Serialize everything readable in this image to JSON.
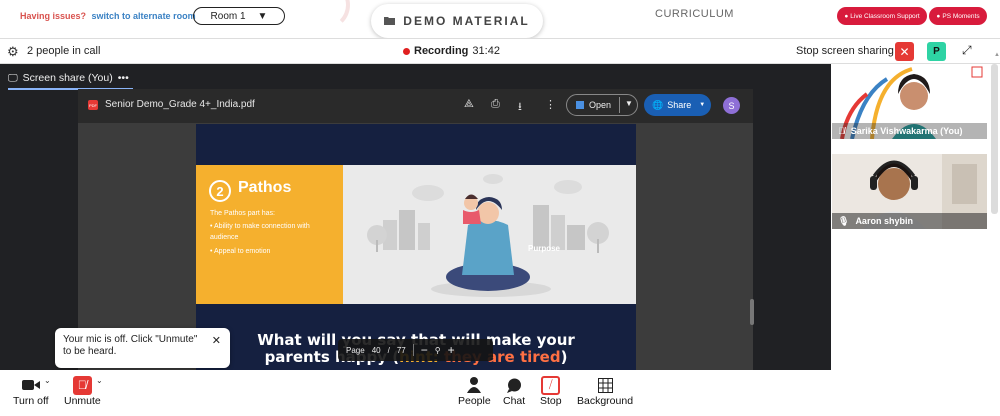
{
  "topbar": {
    "issues_question": "Having issues?",
    "issues_link": "switch to alternate room",
    "room_label": "Room 1",
    "demo_material": "DEMO MATERIAL",
    "curriculum": "CURRICULUM",
    "live_support": "Live Classroom Support",
    "ps_moments": "PS Moments"
  },
  "call": {
    "people_count": "2 people in call",
    "recording_label": "Recording",
    "recording_time": "31:42",
    "stop_share_label": "Stop screen sharing",
    "avatar_letter": "P"
  },
  "screen_share": {
    "tab_label": "Screen share (You)",
    "more": "•••"
  },
  "pdf": {
    "file_name": "Senior Demo_Grade 4+_India.pdf",
    "open_label": "Open",
    "share_label": "Share",
    "avatar_letter": "S",
    "page_label": "Page",
    "current_page": "40",
    "total_pages": "77"
  },
  "slide": {
    "number": "2",
    "title": "Pathos",
    "intro": "The Pathos part has:",
    "bullets": [
      "Ability to make connection with audience",
      "Appeal to emotion"
    ],
    "purpose": "Purpose",
    "headline_1": "What will you say that will make your",
    "headline_2a": "parents happy (",
    "headline_hint": "hint:",
    "headline_tired": " they are tired",
    "headline_2b": ")"
  },
  "tooltip": {
    "text": "Your mic is off. Click \"Unmute\" to be heard."
  },
  "participants": [
    {
      "name": "Sarika Vishwakarma (You)"
    },
    {
      "name": "Aaron shybin"
    }
  ],
  "bottom": {
    "turn_off": "Turn off",
    "unmute": "Unmute",
    "people": "People",
    "chat": "Chat",
    "stop": "Stop",
    "background": "Background"
  },
  "colors": {
    "accent_red": "#e53935",
    "brand_red": "#d81b3c",
    "slide_orange": "#f5b02e",
    "slide_navy": "#152040",
    "avatar_green": "#2ed3a4"
  }
}
